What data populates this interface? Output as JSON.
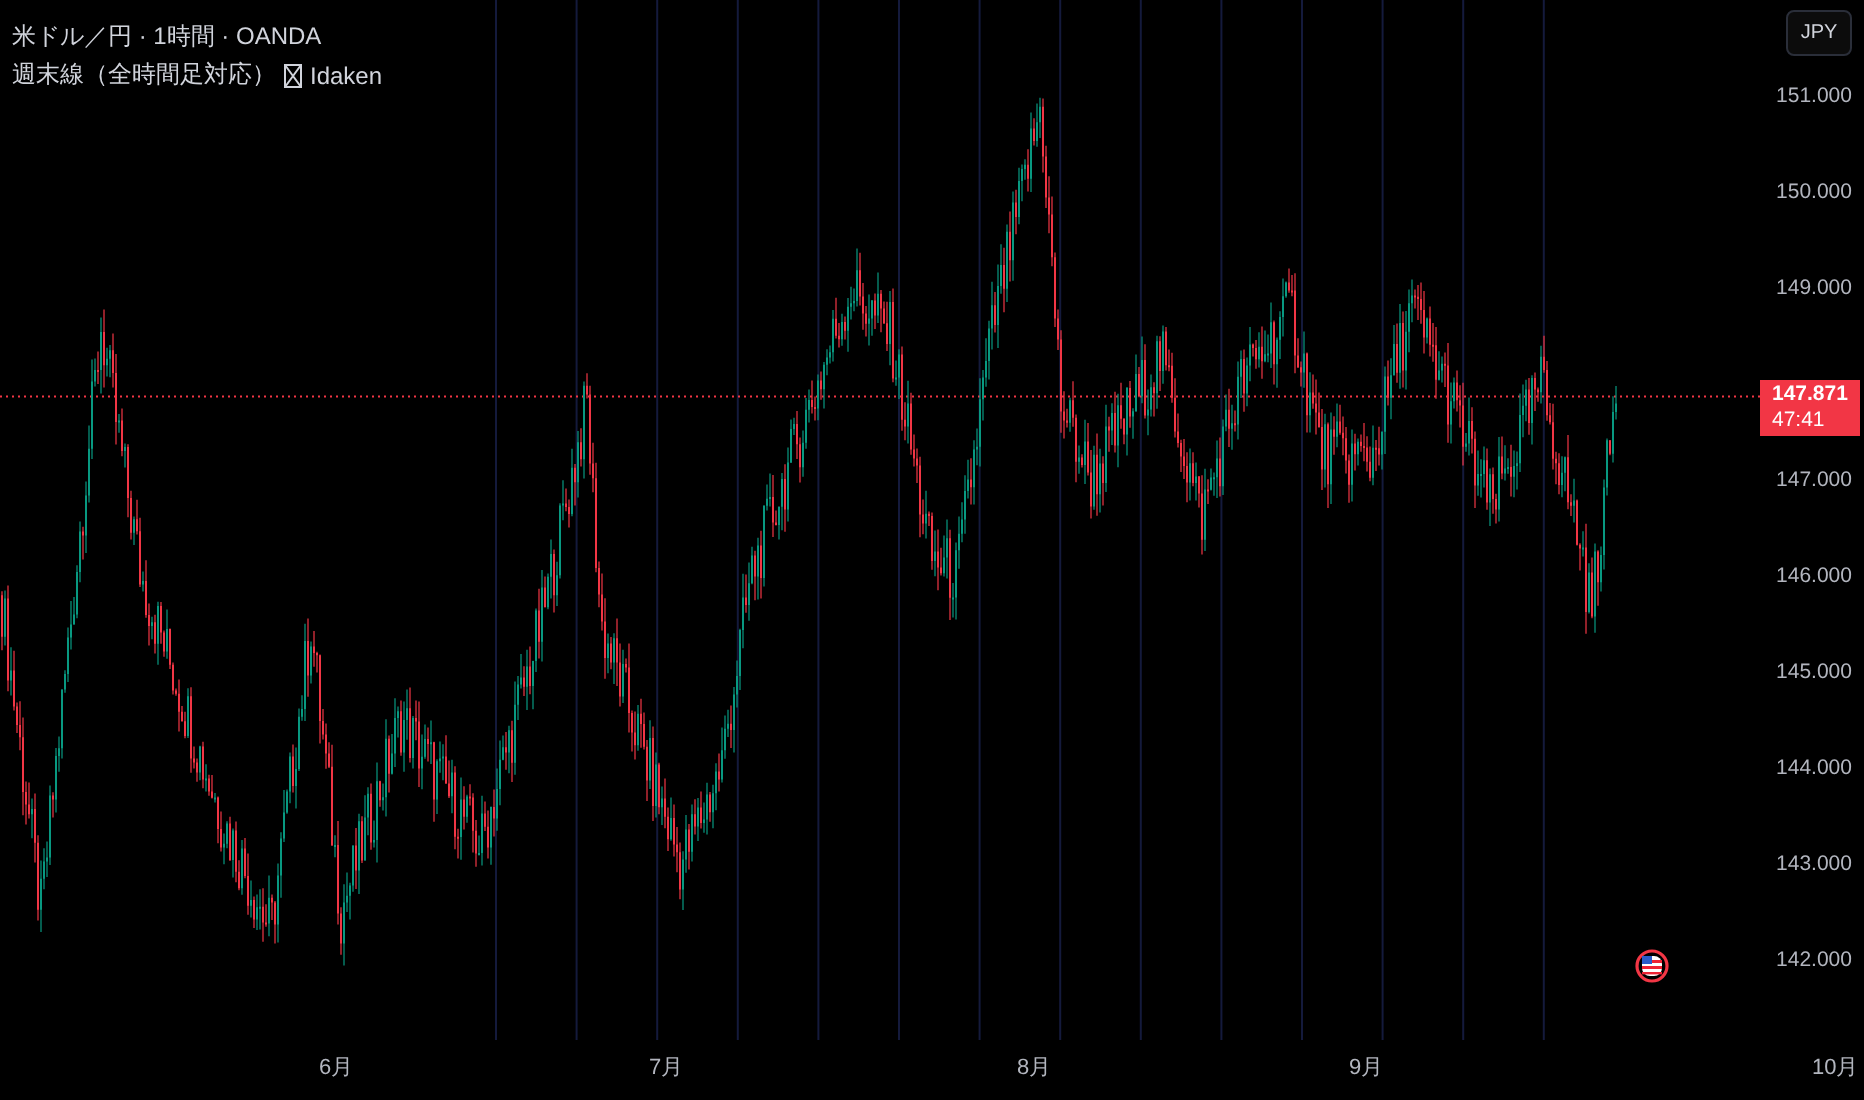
{
  "legend": {
    "symbol": "米ドル／円 · 1時間 · OANDA",
    "indicator": "週末線（全時間足対応）",
    "author": "Idaken"
  },
  "currency_button": {
    "label": "JPY"
  },
  "price_axis": {
    "ticks": [
      "151.000",
      "150.000",
      "149.000",
      "147.000",
      "146.000",
      "145.000",
      "144.000",
      "143.000",
      "142.000"
    ]
  },
  "last_price": {
    "price": "147.871",
    "countdown": "47:41"
  },
  "time_axis": {
    "labels": [
      "6月",
      "7月",
      "8月",
      "9月",
      "10月"
    ]
  }
}
